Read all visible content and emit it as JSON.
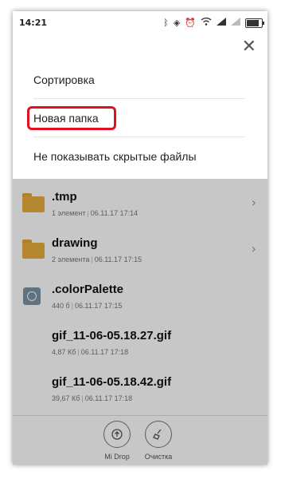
{
  "status_bar": {
    "time": "14:21"
  },
  "menu": {
    "close_icon": "close-icon",
    "items": [
      {
        "label": "Сортировка"
      },
      {
        "label": "Новая папка",
        "highlighted": true
      },
      {
        "label": "Не показывать скрытые файлы"
      }
    ]
  },
  "files": [
    {
      "name": ".tmp",
      "info": "1 элемент",
      "date": "06.11.17 17:14",
      "type": "folder"
    },
    {
      "name": "drawing",
      "info": "2 элемента",
      "date": "06.11.17 17:15",
      "type": "folder"
    },
    {
      "name": ".colorPalette",
      "info": "440 б",
      "date": "06.11.17 17:15",
      "type": "file"
    },
    {
      "name": "gif_11-06-05.18.27.gif",
      "info": "4,87 Кб",
      "date": "06.11.17 17:18",
      "type": "image"
    },
    {
      "name": "gif_11-06-05.18.42.gif",
      "info": "39,67 Кб",
      "date": "06.11.17 17:18",
      "type": "image"
    }
  ],
  "bottom_bar": {
    "mi_drop": "Mi Drop",
    "cleanup": "Очистка"
  },
  "colors": {
    "folder": "#e8ad3e",
    "highlight": "#e0101e"
  }
}
